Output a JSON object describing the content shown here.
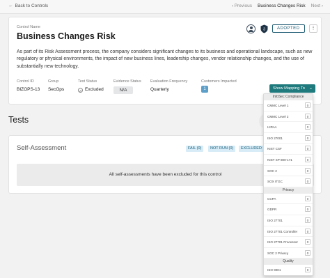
{
  "nav": {
    "back_label": "Back to Controls",
    "back_icon": "arrow-left-icon",
    "prev_label": "Previous",
    "current_label": "Business Changes Risk",
    "next_label": "Next"
  },
  "control": {
    "name_label": "Control Name",
    "title": "Business Changes Risk",
    "status_badge": "ADOPTED",
    "more_label": "⋮",
    "description": "As part of its Risk Assessment process, the company considers significant changes to its business and operational landscape, such as new regulatory or physical environments, the impact of new business lines, leadership changes, vendor relationship changes, and the use of substantially new technology.",
    "fields": {
      "id_label": "Control ID",
      "id_value": "BIZOPS-13",
      "group_label": "Group",
      "group_value": "SecOps",
      "test_status_label": "Test Status",
      "test_status_value": "Excluded",
      "evidence_status_label": "Evidence Status",
      "evidence_status_value": "N/A",
      "eval_freq_label": "Evaluation Frequency",
      "eval_freq_value": "Quarterly",
      "customers_label": "Customers Impacted",
      "customers_value": "1"
    },
    "show_mapping_label": "Show Mapping To"
  },
  "tests": {
    "heading": "Tests",
    "self_assessment": {
      "title": "Self-Assessment",
      "fail_label": "FAIL (0)",
      "notrun_label": "NOT RUN (0)",
      "excluded_label": "EXCLUDED",
      "empty_message": "All self-assessments have been excluded for this control"
    }
  },
  "mapping_dropdown": {
    "groups": [
      {
        "name": "InfoSec Compliance",
        "items": [
          {
            "label": "CMMC Level 1",
            "count": "0"
          },
          {
            "label": "CMMC Level 2",
            "count": "0"
          },
          {
            "label": "HIPAA",
            "count": "0"
          },
          {
            "label": "ISO 27001",
            "count": "0"
          },
          {
            "label": "NIST CSF",
            "count": "0"
          },
          {
            "label": "NIST SP 800-171",
            "count": "0"
          },
          {
            "label": "SOC 2",
            "count": "0"
          },
          {
            "label": "SOX ITGC",
            "count": "0"
          }
        ]
      },
      {
        "name": "Privacy",
        "items": [
          {
            "label": "CCPA",
            "count": "0"
          },
          {
            "label": "GDPR",
            "count": "0"
          },
          {
            "label": "ISO 27701",
            "count": "0"
          },
          {
            "label": "ISO 27701 Controller",
            "count": "0"
          },
          {
            "label": "ISO 27701 Processor",
            "count": "0"
          },
          {
            "label": "SOC 2 Privacy",
            "count": "0"
          }
        ]
      },
      {
        "name": "Quality",
        "items": [
          {
            "label": "ISO 9001",
            "count": "0"
          }
        ]
      }
    ]
  },
  "colors": {
    "accent_teal": "#1e7a7d",
    "badge_blue": "#1e5b73",
    "customers_badge": "#5d9fc8"
  }
}
